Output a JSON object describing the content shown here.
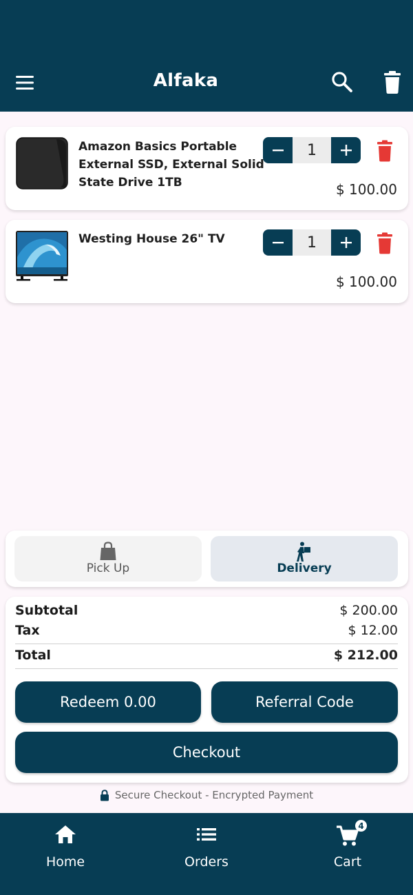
{
  "header": {
    "title": "Alfaka",
    "menu_icon": "menu-icon",
    "search_icon": "search-icon",
    "clear_cart_icon": "trash-icon"
  },
  "cart": {
    "items": [
      {
        "name": "Amazon Basics Portable External SSD, External Solid State Drive 1TB",
        "quantity": "1",
        "price": "$ 100.00"
      },
      {
        "name": "Westing House 26\" TV",
        "quantity": "1",
        "price": "$ 100.00"
      }
    ]
  },
  "fulfillment": {
    "options": [
      {
        "label": "Pick Up",
        "icon": "shopping-bag-icon",
        "selected": false
      },
      {
        "label": "Delivery",
        "icon": "delivery-person-icon",
        "selected": true
      }
    ]
  },
  "summary": {
    "subtotal_label": "Subtotal",
    "subtotal": "$ 200.00",
    "tax_label": "Tax",
    "tax": "$ 12.00",
    "total_label": "Total",
    "total": "$ 212.00"
  },
  "actions": {
    "redeem": "Redeem 0.00",
    "referral": "Referral Code",
    "checkout": "Checkout"
  },
  "secure_note": "Secure Checkout - Encrypted Payment",
  "nav": {
    "items": [
      {
        "label": "Home",
        "icon": "home-icon"
      },
      {
        "label": "Orders",
        "icon": "list-icon"
      },
      {
        "label": "Cart",
        "icon": "cart-icon",
        "badge": "4"
      }
    ]
  },
  "colors": {
    "primary": "#073d54",
    "delete": "#e53935",
    "background": "#fdf6fb"
  }
}
